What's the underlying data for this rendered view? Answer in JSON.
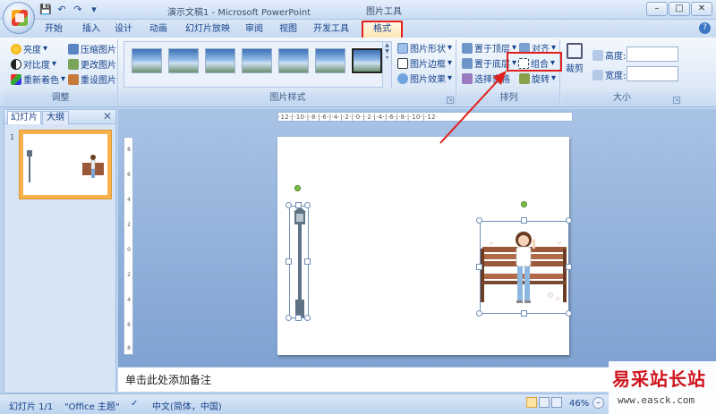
{
  "window": {
    "title": "演示文稿1 - Microsoft PowerPoint",
    "contextual_tools": "图片工具"
  },
  "tabs": [
    "开始",
    "插入",
    "设计",
    "动画",
    "幻灯片放映",
    "审阅",
    "视图",
    "开发工具",
    "格式"
  ],
  "active_tab": "格式",
  "ribbon": {
    "adjust": {
      "label": "调整",
      "brightness": "亮度",
      "contrast": "对比度",
      "recolor": "重新着色",
      "compress": "压缩图片",
      "change_picture": "更改图片",
      "reset_picture": "重设图片"
    },
    "styles": {
      "label": "图片样式",
      "shape": "图片形状",
      "border": "图片边框",
      "effects": "图片效果"
    },
    "arrange": {
      "label": "排列",
      "bring_front": "置于顶层",
      "send_back": "置于底层",
      "selection_pane": "选择窗格",
      "align": "对齐",
      "group": "组合",
      "rotate": "旋转"
    },
    "size": {
      "label": "大小",
      "crop": "裁剪",
      "height": "高度:",
      "width": "宽度:",
      "height_value": "",
      "width_value": ""
    }
  },
  "left_panel": {
    "tab_slides": "幻灯片",
    "tab_outline": "大纲",
    "slide_number": "1"
  },
  "ruler": {
    "horizontal": "·12·|·10·|·8·|·6·|·4·|·2·|·0·|·2·|·4·|·6·|·8·|·10·|·12·",
    "vertical": [
      "8",
      "6",
      "4",
      "2",
      "0",
      "2",
      "4",
      "6",
      "8"
    ]
  },
  "notes": {
    "placeholder": "单击此处添加备注"
  },
  "status": {
    "slide": "幻灯片 1/1",
    "theme": "\"Office 主题\"",
    "language": "中文(简体，中国)",
    "zoom": "46%"
  },
  "watermark": {
    "title": "易采站长站",
    "url": "www.easck.com"
  },
  "colors": {
    "highlight": "#e0201b",
    "accent": "#15428b"
  }
}
